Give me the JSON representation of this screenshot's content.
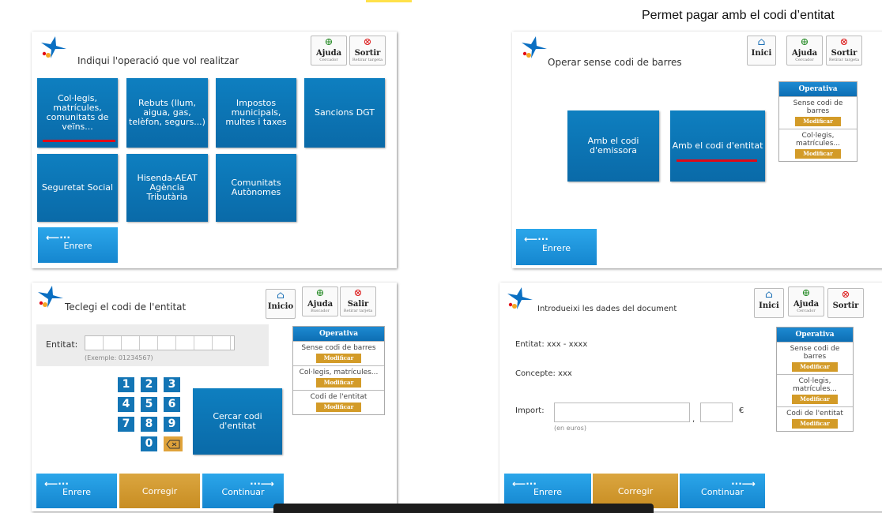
{
  "caption": "Permet pagar amb el codi d’entitat",
  "panel1": {
    "title": "Indiqui l'operació que vol realitzar",
    "ajuda": "Ajuda",
    "ajuda_sub": "Cercador",
    "sortir": "Sortir",
    "sortir_sub": "Retirar targeta",
    "tiles": [
      "Col·legis, matrícules, comunitats de veïns...",
      "Rebuts (llum, aigua, gas, telèfon, segurs...)",
      "Impostos municipals, multes i taxes",
      "Sancions DGT",
      "Seguretat Social",
      "Hisenda-AEAT Agència Tributària",
      "Comunitats Autònomes"
    ],
    "back": "Enrere"
  },
  "panel2": {
    "title": "Operar sense codi de barres",
    "inici": "Inici",
    "ajuda": "Ajuda",
    "ajuda_sub": "Cercador",
    "sortir": "Sortir",
    "sortir_sub": "Retirar targeta",
    "tiles": [
      "Amb el codi d'emissora",
      "Amb el codi d'entitat"
    ],
    "op_head": "Operativa",
    "op_items": [
      "Sense codi de barres",
      "Col·legis, matrícules..."
    ],
    "modify": "Modificar",
    "back": "Enrere"
  },
  "panel3": {
    "title": "Teclegi el codi de l'entitat",
    "inici": "Inicio",
    "ajuda": "Ajuda",
    "ajuda_sub": "Buscador",
    "salir": "Salir",
    "salir_sub": "Retirar tarjeta",
    "entitat_label": "Entitat:",
    "example": "(Exemple: 01234567)",
    "keys": [
      "1",
      "2",
      "3",
      "4",
      "5",
      "6",
      "7",
      "8",
      "9",
      "0"
    ],
    "search": "Cercar codi d'entitat",
    "op_head": "Operativa",
    "op_items": [
      "Sense codi de barres",
      "Col·legis, matrícules...",
      "Codi de l'entitat"
    ],
    "modify": "Modificar",
    "back": "Enrere",
    "fix": "Corregir",
    "next": "Continuar"
  },
  "panel4": {
    "title": "Introdueixi les dades del document",
    "inici": "Inici",
    "ajuda": "Ajuda",
    "ajuda_sub": "Cercador",
    "sortir": "Sortir",
    "entitat": "Entitat: xxx - xxxx",
    "concepte": "Concepte: xxx",
    "import_label": "Import:",
    "comma": ",",
    "euro": "€",
    "hint": "(en euros)",
    "op_head": "Operativa",
    "op_items": [
      "Sense codi de barres",
      "Col·legis, matrícules...",
      "Codi de l'entitat"
    ],
    "modify": "Modificar",
    "back": "Enrere",
    "fix": "Corregir",
    "next": "Continuar"
  }
}
